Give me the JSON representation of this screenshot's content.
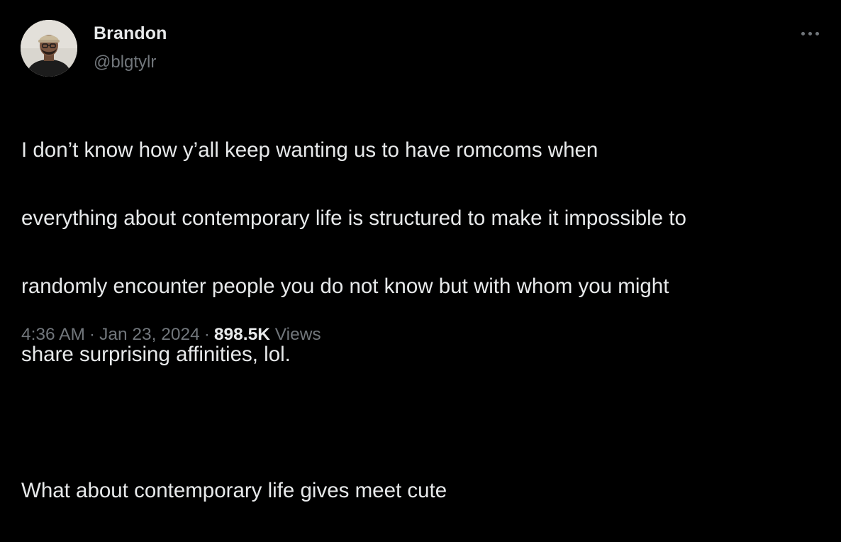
{
  "author": {
    "name": "Brandon",
    "handle": "@blgtylr"
  },
  "tweet": {
    "lines": [
      "I don’t know how y’all keep wanting us to have romcoms when",
      "everything about contemporary life is structured to make it impossible to",
      "randomly encounter people you do not know but with whom you might",
      "share surprising affinities, lol."
    ],
    "line2": "What about contemporary life gives meet cute"
  },
  "meta": {
    "time": "4:36 AM",
    "separator": "·",
    "date": "Jan 23, 2024",
    "views_count": "898.5K",
    "views_label": "Views"
  },
  "icons": {
    "more": "more-horizontal-icon",
    "avatar": "profile-photo"
  },
  "colors": {
    "background": "#000000",
    "primary_text": "#e7e9ea",
    "secondary_text": "#71767b"
  }
}
